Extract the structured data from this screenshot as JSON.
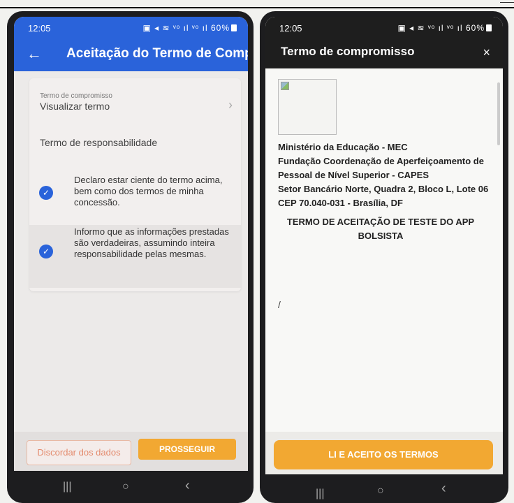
{
  "left_screen": {
    "status": {
      "time": "12:05",
      "icons": "▣ ◂ ≋ ᵛᵒ ıl ᵛᵒ ıl 60%"
    },
    "app_bar": {
      "back_icon": "←",
      "title": "Aceitação do Termo de Comp..."
    },
    "term": {
      "caption": "Termo de compromisso",
      "link": "Visualizar termo",
      "chevron": "›"
    },
    "responsibility_title": "Termo de responsabilidade",
    "checkboxes": [
      {
        "text": "Declaro estar ciente do termo acima, bem como dos termos de minha concessão.",
        "checked": true
      },
      {
        "text": "Informo que as informações prestadas são verdadeiras, assumindo inteira responsabilidade pelas mesmas.",
        "checked": true
      }
    ],
    "buttons": {
      "disagree": "Discordar dos dados",
      "proceed": "PROSSEGUIR"
    },
    "nav": {
      "recents": "|||",
      "home": "○",
      "back": "‹"
    }
  },
  "right_screen": {
    "status": {
      "time": "12:05",
      "icons": "▣ ◂ ≋ ᵛᵒ ıl ᵛᵒ ıl 60%"
    },
    "header": {
      "title": "Termo de compromisso",
      "close_icon": "×"
    },
    "address_lines": [
      "Ministério da Educação - MEC",
      "Fundação Coordenação de Aperfeiçoamento de",
      "Pessoal de Nível Superior - CAPES",
      "Setor Bancário Norte, Quadra 2, Bloco L, Lote 06",
      "CEP 70.040-031 - Brasília, DF"
    ],
    "heading": "TERMO DE ACEITAÇÃO DE TESTE DO APP BOLSISTA",
    "slash": "/",
    "accept_button": "LI E ACEITO OS TERMOS",
    "nav": {
      "recents": "|||",
      "home": "○",
      "back": "‹"
    }
  },
  "colors": {
    "primary": "#2a63da",
    "accent": "#f2a832",
    "modal_header": "#1e1e1e"
  }
}
